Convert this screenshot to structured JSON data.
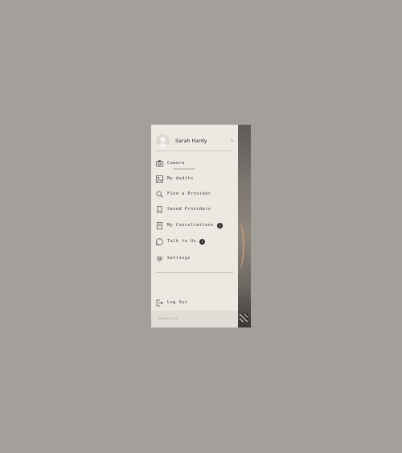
{
  "user": {
    "name": "Sarah Hardy"
  },
  "menu": {
    "items": [
      {
        "label": "Camera",
        "icon": "camera-icon"
      },
      {
        "label": "My Audits",
        "icon": "audit-icon"
      },
      {
        "label": "Find a Provider",
        "icon": "search-icon"
      },
      {
        "label": "Saved Providers",
        "icon": "bookmark-icon"
      },
      {
        "label": "My Consultations",
        "icon": "document-icon",
        "badge": "1"
      },
      {
        "label": "Talk to Us",
        "icon": "chat-icon",
        "badge": "2"
      },
      {
        "label": "Settings",
        "icon": "gear-icon"
      }
    ],
    "logout": {
      "label": "Log Out",
      "icon": "logout-icon"
    }
  },
  "footer": {
    "version": "Version 1.0.5"
  },
  "colors": {
    "drawer_bg": "#ece9e2",
    "badge_bg": "#2c2a28",
    "page_bg": "#a3a09c"
  }
}
